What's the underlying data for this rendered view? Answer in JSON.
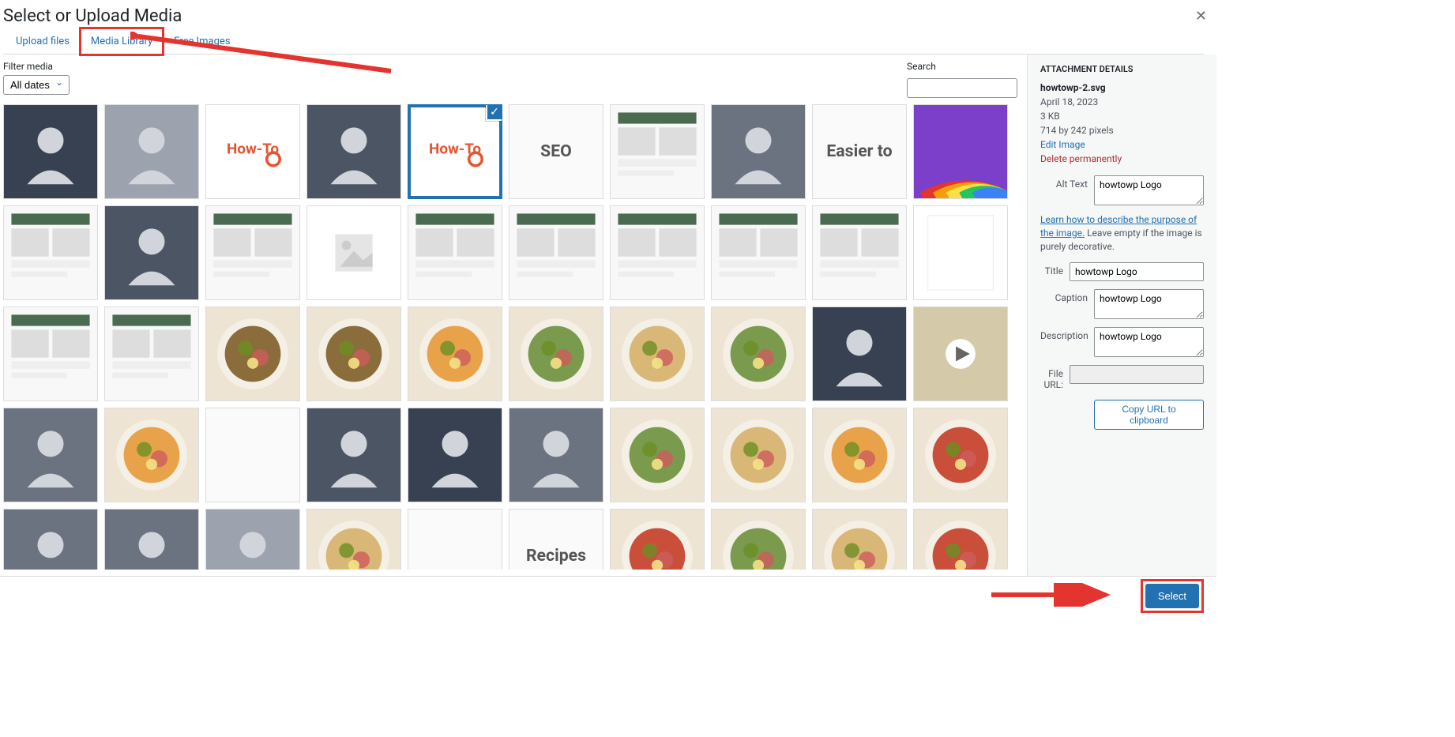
{
  "modal_title": "Select or Upload Media",
  "tabs": [
    "Upload files",
    "Media Library",
    "Free Images"
  ],
  "active_tab": 1,
  "filter": {
    "label": "Filter media",
    "value": "All dates"
  },
  "search": {
    "label": "Search",
    "value": ""
  },
  "attachment": {
    "section_title": "ATTACHMENT DETAILS",
    "filename": "howtowp-2.svg",
    "date": "April 18, 2023",
    "size": "3 KB",
    "dims": "714 by 242 pixels",
    "edit": "Edit Image",
    "delete": "Delete permanently",
    "alt_label": "Alt Text",
    "alt_value": "howtowp Logo",
    "help_link": "Learn how to describe the purpose of the image.",
    "help_rest": " Leave empty if the image is purely decorative.",
    "title_label": "Title",
    "title_value": "howtowp Logo",
    "caption_label": "Caption",
    "caption_value": "howtowp Logo",
    "desc_label": "Description",
    "desc_value": "howtowp Logo",
    "fileurl_label": "File URL:",
    "fileurl_value": "",
    "copy_btn": "Copy URL to clipboard"
  },
  "footer": {
    "select": "Select"
  },
  "grid": {
    "rows": 5,
    "cols": 10,
    "selected_index": 4,
    "items": [
      {
        "name": "building",
        "kind": "photo"
      },
      {
        "name": "man-sitting",
        "kind": "photo"
      },
      {
        "name": "howto-orange",
        "kind": "logo",
        "text": "How-To"
      },
      {
        "name": "laptop",
        "kind": "photo"
      },
      {
        "name": "howto-logo",
        "kind": "logo",
        "text": "How-To"
      },
      {
        "name": "seo",
        "kind": "text",
        "text": "SEO"
      },
      {
        "name": "devices",
        "kind": "ui"
      },
      {
        "name": "crowd",
        "kind": "photo"
      },
      {
        "name": "easier",
        "kind": "text",
        "text": "Easier to"
      },
      {
        "name": "rainbow",
        "kind": "rainbow"
      },
      {
        "name": "iphone-x",
        "kind": "ui"
      },
      {
        "name": "portrait-hat",
        "kind": "photo"
      },
      {
        "name": "responsive",
        "kind": "ui"
      },
      {
        "name": "placeholder",
        "kind": "placeholder"
      },
      {
        "name": "food-layout-1",
        "kind": "ui"
      },
      {
        "name": "food-layout-2",
        "kind": "ui"
      },
      {
        "name": "food-layout-3",
        "kind": "ui"
      },
      {
        "name": "food-layout-4",
        "kind": "ui"
      },
      {
        "name": "food-layout-5",
        "kind": "ui"
      },
      {
        "name": "blank-page",
        "kind": "blank"
      },
      {
        "name": "site-1",
        "kind": "ui"
      },
      {
        "name": "site-2",
        "kind": "ui"
      },
      {
        "name": "salad-bowl",
        "kind": "food"
      },
      {
        "name": "breakfast",
        "kind": "food"
      },
      {
        "name": "eggs",
        "kind": "food"
      },
      {
        "name": "fried-egg",
        "kind": "food"
      },
      {
        "name": "burger",
        "kind": "food"
      },
      {
        "name": "pasta",
        "kind": "food"
      },
      {
        "name": "phone-food",
        "kind": "photo"
      },
      {
        "name": "play-thumb",
        "kind": "play"
      },
      {
        "name": "woman-cooking",
        "kind": "photo"
      },
      {
        "name": "chopping",
        "kind": "food"
      },
      {
        "name": "signature",
        "kind": "text"
      },
      {
        "name": "woman-black",
        "kind": "photo"
      },
      {
        "name": "woman-smile",
        "kind": "photo"
      },
      {
        "name": "man-sunglasses",
        "kind": "photo"
      },
      {
        "name": "avocado-toast",
        "kind": "food"
      },
      {
        "name": "tacos",
        "kind": "food"
      },
      {
        "name": "grain-bowl",
        "kind": "food"
      },
      {
        "name": "brussels",
        "kind": "food"
      },
      {
        "name": "woman-asian",
        "kind": "photo"
      },
      {
        "name": "man-gray",
        "kind": "photo"
      },
      {
        "name": "man-white",
        "kind": "photo"
      },
      {
        "name": "pancakes",
        "kind": "food"
      },
      {
        "name": "signature-2",
        "kind": "text"
      },
      {
        "name": "recipes",
        "kind": "text",
        "text": "Recipes"
      },
      {
        "name": "broccoli",
        "kind": "food"
      },
      {
        "name": "veg-top",
        "kind": "food"
      },
      {
        "name": "citrus",
        "kind": "food"
      },
      {
        "name": "salad-2",
        "kind": "food"
      }
    ]
  }
}
